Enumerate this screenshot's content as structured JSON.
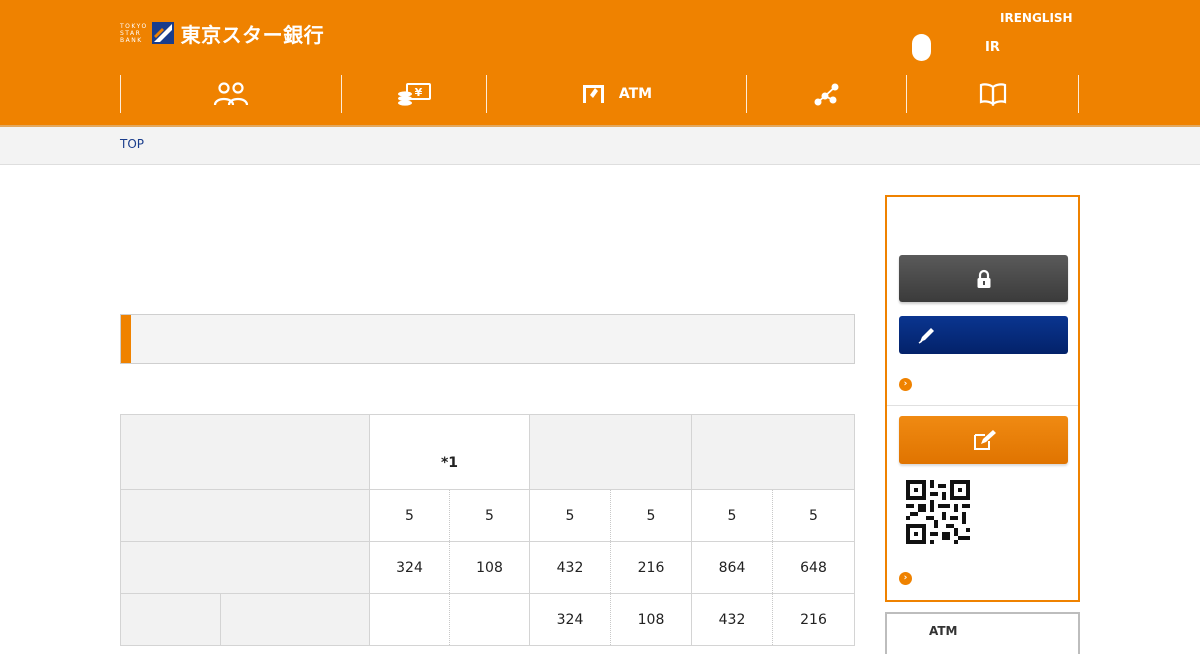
{
  "header": {
    "logo_small_lines": [
      "TOKYO",
      "STAR",
      "BANK"
    ],
    "logo_text": "東京スター銀行",
    "util_links": {
      "ir_english": "IRENGLISH",
      "ir": "IR"
    },
    "nav": [
      {
        "icon": "people-icon",
        "label": ""
      },
      {
        "icon": "money-icon",
        "label": ""
      },
      {
        "icon": "atm-icon",
        "label": "ATM"
      },
      {
        "icon": "branch-network-icon",
        "label": ""
      },
      {
        "icon": "book-icon",
        "label": ""
      }
    ],
    "colors": {
      "brand_orange": "#ef8200",
      "navy": "#03226a"
    }
  },
  "breadcrumb": {
    "top": "TOP"
  },
  "fee_table": {
    "header_note": "*1",
    "row_counts": [
      "5",
      "5",
      "5",
      "5",
      "5",
      "5"
    ],
    "row_fees_1": [
      "324",
      "108",
      "432",
      "216",
      "864",
      "648"
    ],
    "row_fees_2": [
      "",
      "",
      "324",
      "108",
      "432",
      "216"
    ]
  },
  "sidebar": {
    "buttons": [
      {
        "icon": "lock-icon",
        "label": ""
      },
      {
        "icon": "pen-icon",
        "label": ""
      },
      {
        "icon": "form-edit-icon",
        "label": ""
      }
    ],
    "arrow_glyph": "›",
    "qr_icon": "qr-code-icon"
  },
  "sidebar2": {
    "label": "ATM"
  }
}
